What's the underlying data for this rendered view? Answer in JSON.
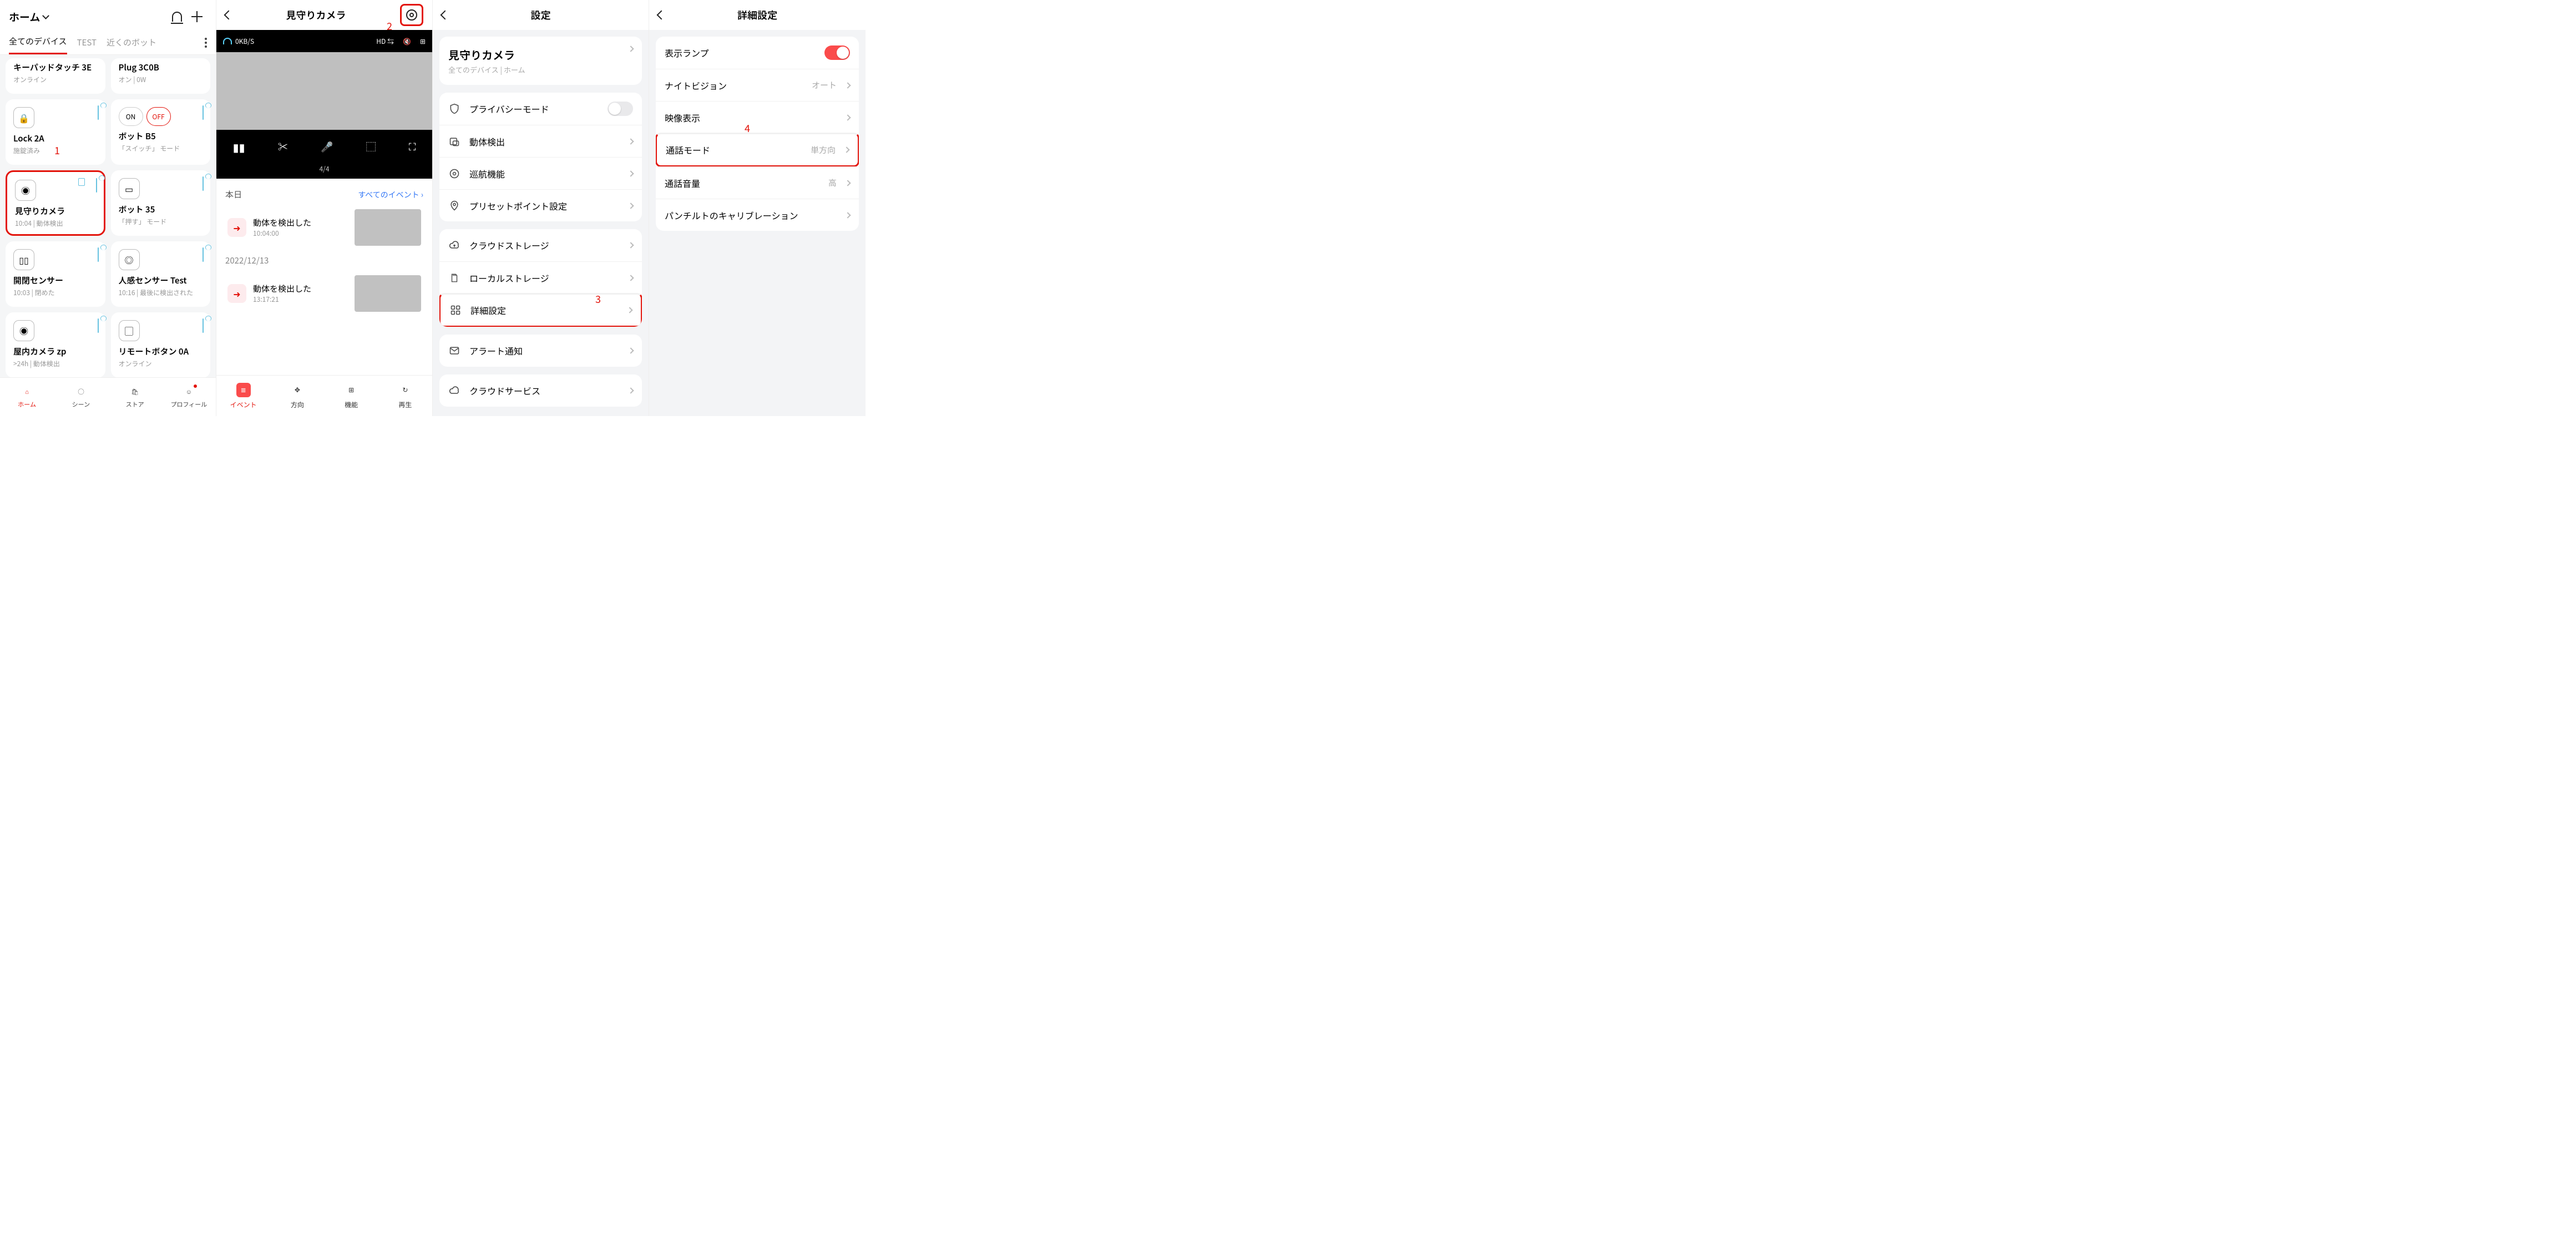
{
  "annotations": {
    "a1": "1",
    "a2": "2",
    "a3": "3",
    "a4": "4"
  },
  "s1": {
    "home": "ホーム",
    "tabs": {
      "all": "全てのデバイス",
      "test": "TEST",
      "near": "近くのボット"
    },
    "cards": {
      "keypad": {
        "name": "キーパッドタッチ 3E",
        "sub": "オンライン"
      },
      "plug": {
        "name": "Plug 3C0B",
        "sub": "オン | 0W"
      },
      "lock": {
        "name": "Lock 2A",
        "sub": "施錠済み"
      },
      "bot5": {
        "name": "ボット B5",
        "sub": "「スイッチ」 モード",
        "on": "ON",
        "off": "OFF"
      },
      "cam": {
        "name": "見守りカメラ",
        "sub": "10:04 | 動体検出"
      },
      "bot35": {
        "name": "ボット 35",
        "sub": "「押す」 モード"
      },
      "contact": {
        "name": "開閉センサー",
        "sub": "10:03 | 閉めた"
      },
      "motion": {
        "name": "人感センサー Test",
        "sub": "10:16 | 最後に検出された"
      },
      "indoor": {
        "name": "屋内カメラ zp",
        "sub": ">24h | 動体検出"
      },
      "remote": {
        "name": "リモートボタン 0A",
        "sub": "オンライン"
      }
    },
    "tabbar": {
      "home": "ホーム",
      "scene": "シーン",
      "store": "ストア",
      "profile": "プロフィール"
    }
  },
  "s2": {
    "title": "見守りカメラ",
    "rate": "0KB/S",
    "hd": "HD",
    "pos": "4/4",
    "today": "本日",
    "allEvents": "すべてのイベント",
    "ev1": {
      "t": "動体を検出した",
      "s": "10:04:00"
    },
    "date2": "2022/12/13",
    "ev2": {
      "t": "動体を検出した",
      "s": "13:17:21"
    },
    "tabs": {
      "event": "イベント",
      "dir": "方向",
      "func": "機能",
      "replay": "再生"
    }
  },
  "s3": {
    "title": "設定",
    "device": {
      "name": "見守りカメラ",
      "sub": "全てのデバイス | ホーム"
    },
    "rows": {
      "privacy": "プライバシーモード",
      "motion": "動体検出",
      "patrol": "巡航機能",
      "preset": "プリセットポイント設定",
      "cloud": "クラウドストレージ",
      "local": "ローカルストレージ",
      "adv": "詳細設定",
      "alert": "アラート通知",
      "cloudsvc": "クラウドサービス"
    }
  },
  "s4": {
    "title": "詳細設定",
    "rows": {
      "lamp": "表示ランプ",
      "night": {
        "l": "ナイトビジョン",
        "v": "オート"
      },
      "video": "映像表示",
      "call": {
        "l": "通話モード",
        "v": "単方向"
      },
      "vol": {
        "l": "通話音量",
        "v": "高"
      },
      "calib": "パンチルトのキャリブレーション"
    }
  }
}
